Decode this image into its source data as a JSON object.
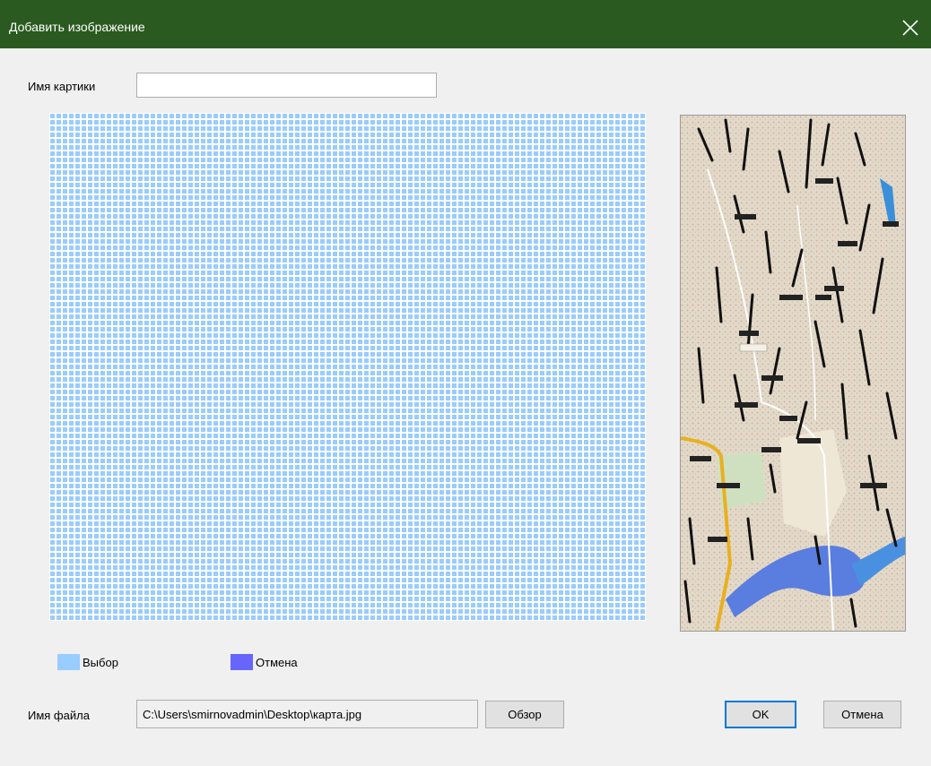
{
  "window": {
    "title": "Добавить изображение",
    "close_icon": "close-icon",
    "title_bar_color": "#2a5a1f"
  },
  "image_name": {
    "label": "Имя картики",
    "value": ""
  },
  "selection_grid": {
    "cell_color": "#99ccff",
    "cell_state": "Выбор"
  },
  "preview": {
    "description_icon": "map-image"
  },
  "legend": {
    "select_label": "Выбор",
    "select_color": "#99ccff",
    "cancel_label": "Отмена",
    "cancel_color": "#6666ff"
  },
  "file": {
    "label": "Имя файла",
    "path": "C:\\Users\\smirnovadmin\\Desktop\\карта.jpg",
    "browse_label": "Обзор"
  },
  "buttons": {
    "ok_label": "OK",
    "cancel_label": "Отмена"
  }
}
